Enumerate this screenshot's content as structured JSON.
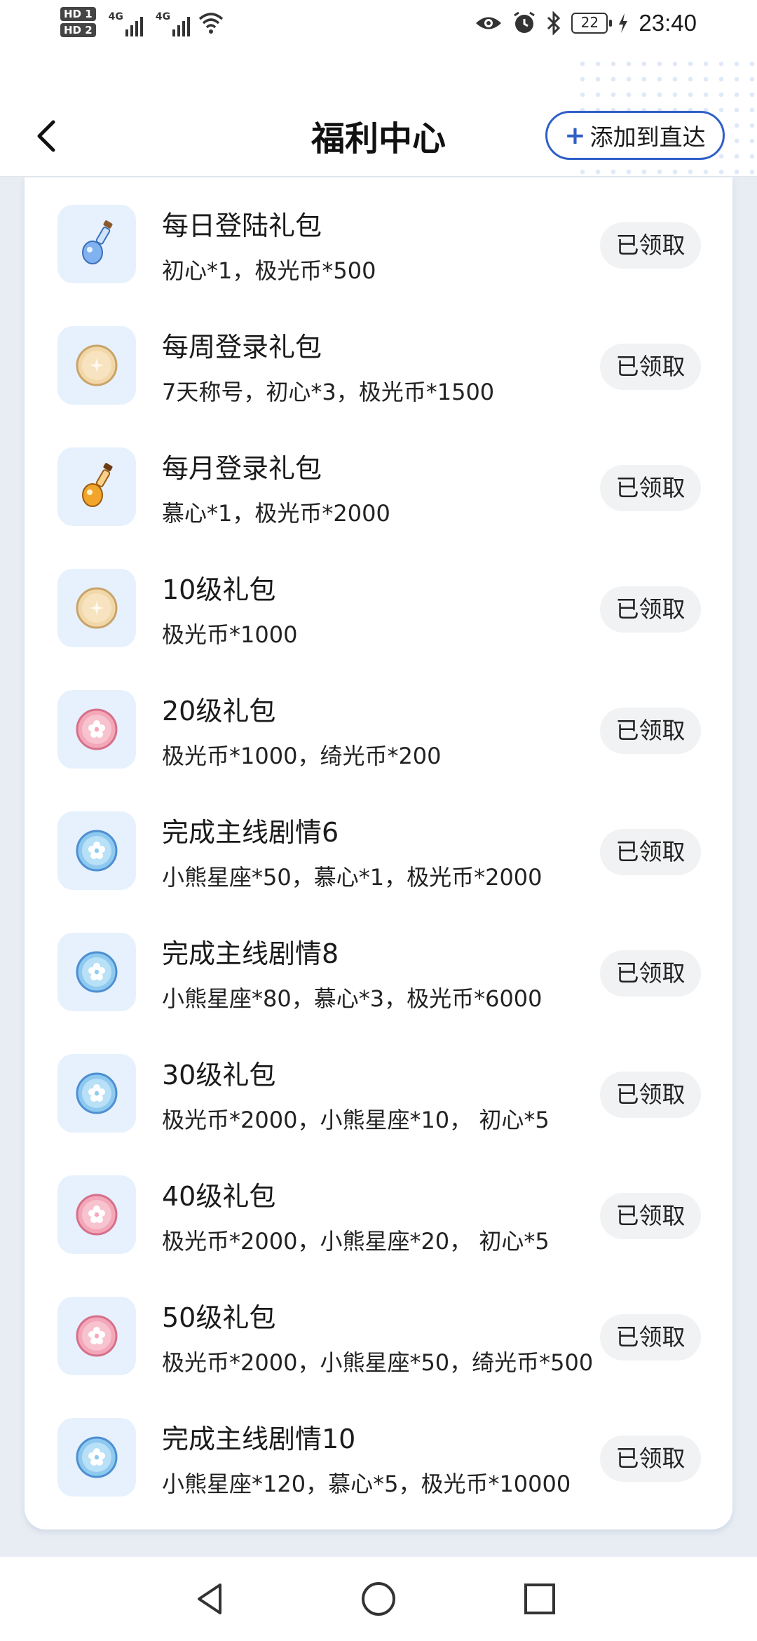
{
  "status_bar": {
    "hd1": "HD 1",
    "hd2": "HD 2",
    "net1": "4G",
    "net2": "4G",
    "battery": "22",
    "time": "23:40"
  },
  "header": {
    "title": "福利中心",
    "add_label": "添加到直达",
    "add_icon": "plus-icon",
    "back_icon": "chevron-left-icon",
    "accent": "#2f5fc7"
  },
  "items": [
    {
      "title": "每日登陆礼包",
      "desc": "初心*1，极光币*500",
      "button": "已领取",
      "icon": "blue-potion-icon"
    },
    {
      "title": "每周登录礼包",
      "desc": "7天称号，初心*3，极光币*1500",
      "button": "已领取",
      "icon": "gold-coin-icon"
    },
    {
      "title": "每月登录礼包",
      "desc": "慕心*1，极光币*2000",
      "button": "已领取",
      "icon": "gold-potion-icon"
    },
    {
      "title": "10级礼包",
      "desc": "极光币*1000",
      "button": "已领取",
      "icon": "gold-coin-icon"
    },
    {
      "title": "20级礼包",
      "desc": "极光币*1000，绮光币*200",
      "button": "已领取",
      "icon": "pink-coin-icon"
    },
    {
      "title": "完成主线剧情6",
      "desc": "小熊星座*50，慕心*1，极光币*2000",
      "button": "已领取",
      "icon": "blue-coin-icon"
    },
    {
      "title": "完成主线剧情8",
      "desc": "小熊星座*80，慕心*3，极光币*6000",
      "button": "已领取",
      "icon": "blue-coin-icon"
    },
    {
      "title": "30级礼包",
      "desc": "极光币*2000，小熊星座*10， 初心*5",
      "button": "已领取",
      "icon": "blue-coin-icon"
    },
    {
      "title": "40级礼包",
      "desc": " 极光币*2000，小熊星座*20， 初心*5",
      "button": "已领取",
      "icon": "pink-coin-icon"
    },
    {
      "title": "50级礼包",
      "desc": " 极光币*2000，小熊星座*50，绮光币*500",
      "button": "已领取",
      "icon": "pink-coin-icon"
    },
    {
      "title": "完成主线剧情10",
      "desc": "小熊星座*120，慕心*5，极光币*10000",
      "button": "已领取",
      "icon": "blue-coin-icon"
    }
  ],
  "nav": {
    "back_icon": "triangle-back-icon",
    "home_icon": "circle-home-icon",
    "recent_icon": "square-recent-icon"
  }
}
